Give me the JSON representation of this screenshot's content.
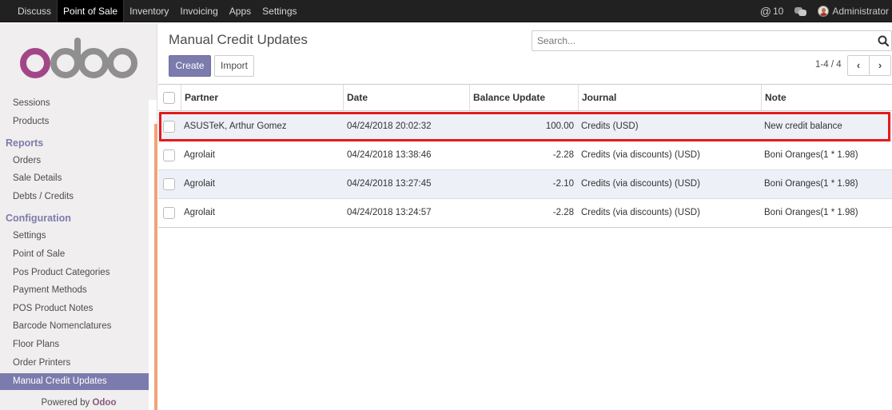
{
  "topbar": {
    "menu": [
      "Discuss",
      "Point of Sale",
      "Inventory",
      "Invoicing",
      "Apps",
      "Settings"
    ],
    "active_index": 1,
    "notifications_count": "10",
    "user_name": "Administrator"
  },
  "sidebar": {
    "items": [
      {
        "label": "Sessions",
        "type": "item"
      },
      {
        "label": "Products",
        "type": "item"
      },
      {
        "label": "Reports",
        "type": "header"
      },
      {
        "label": "Orders",
        "type": "item"
      },
      {
        "label": "Sale Details",
        "type": "item"
      },
      {
        "label": "Debts / Credits",
        "type": "item"
      },
      {
        "label": "Configuration",
        "type": "header"
      },
      {
        "label": "Settings",
        "type": "item"
      },
      {
        "label": "Point of Sale",
        "type": "item"
      },
      {
        "label": "Pos Product Categories",
        "type": "item"
      },
      {
        "label": "Payment Methods",
        "type": "item"
      },
      {
        "label": "POS Product Notes",
        "type": "item"
      },
      {
        "label": "Barcode Nomenclatures",
        "type": "item"
      },
      {
        "label": "Floor Plans",
        "type": "item"
      },
      {
        "label": "Order Printers",
        "type": "item"
      },
      {
        "label": "Manual Credit Updates",
        "type": "item",
        "active": true
      }
    ],
    "powered_by": "Powered by",
    "powered_brand": "Odoo"
  },
  "page": {
    "title": "Manual Credit Updates",
    "search_placeholder": "Search...",
    "create_label": "Create",
    "import_label": "Import",
    "pager_value": "1-4 / 4"
  },
  "table": {
    "columns": [
      "Partner",
      "Date",
      "Balance Update",
      "Journal",
      "Note"
    ],
    "rows": [
      {
        "partner": "ASUSTeK, Arthur Gomez",
        "date": "04/24/2018 20:02:32",
        "balance": "100.00",
        "journal": "Credits (USD)",
        "note": "New credit balance"
      },
      {
        "partner": "Agrolait",
        "date": "04/24/2018 13:38:46",
        "balance": "-2.28",
        "journal": "Credits (via discounts) (USD)",
        "note": "Boni Oranges(1 * 1.98)"
      },
      {
        "partner": "Agrolait",
        "date": "04/24/2018 13:27:45",
        "balance": "-2.10",
        "journal": "Credits (via discounts) (USD)",
        "note": "Boni Oranges(1 * 1.98)"
      },
      {
        "partner": "Agrolait",
        "date": "04/24/2018 13:24:57",
        "balance": "-2.28",
        "journal": "Credits (via discounts) (USD)",
        "note": "Boni Oranges(1 * 1.98)"
      }
    ]
  },
  "colors": {
    "brand": "#875a7b",
    "accent": "#7c7bad",
    "highlight": "#e21b1b"
  }
}
